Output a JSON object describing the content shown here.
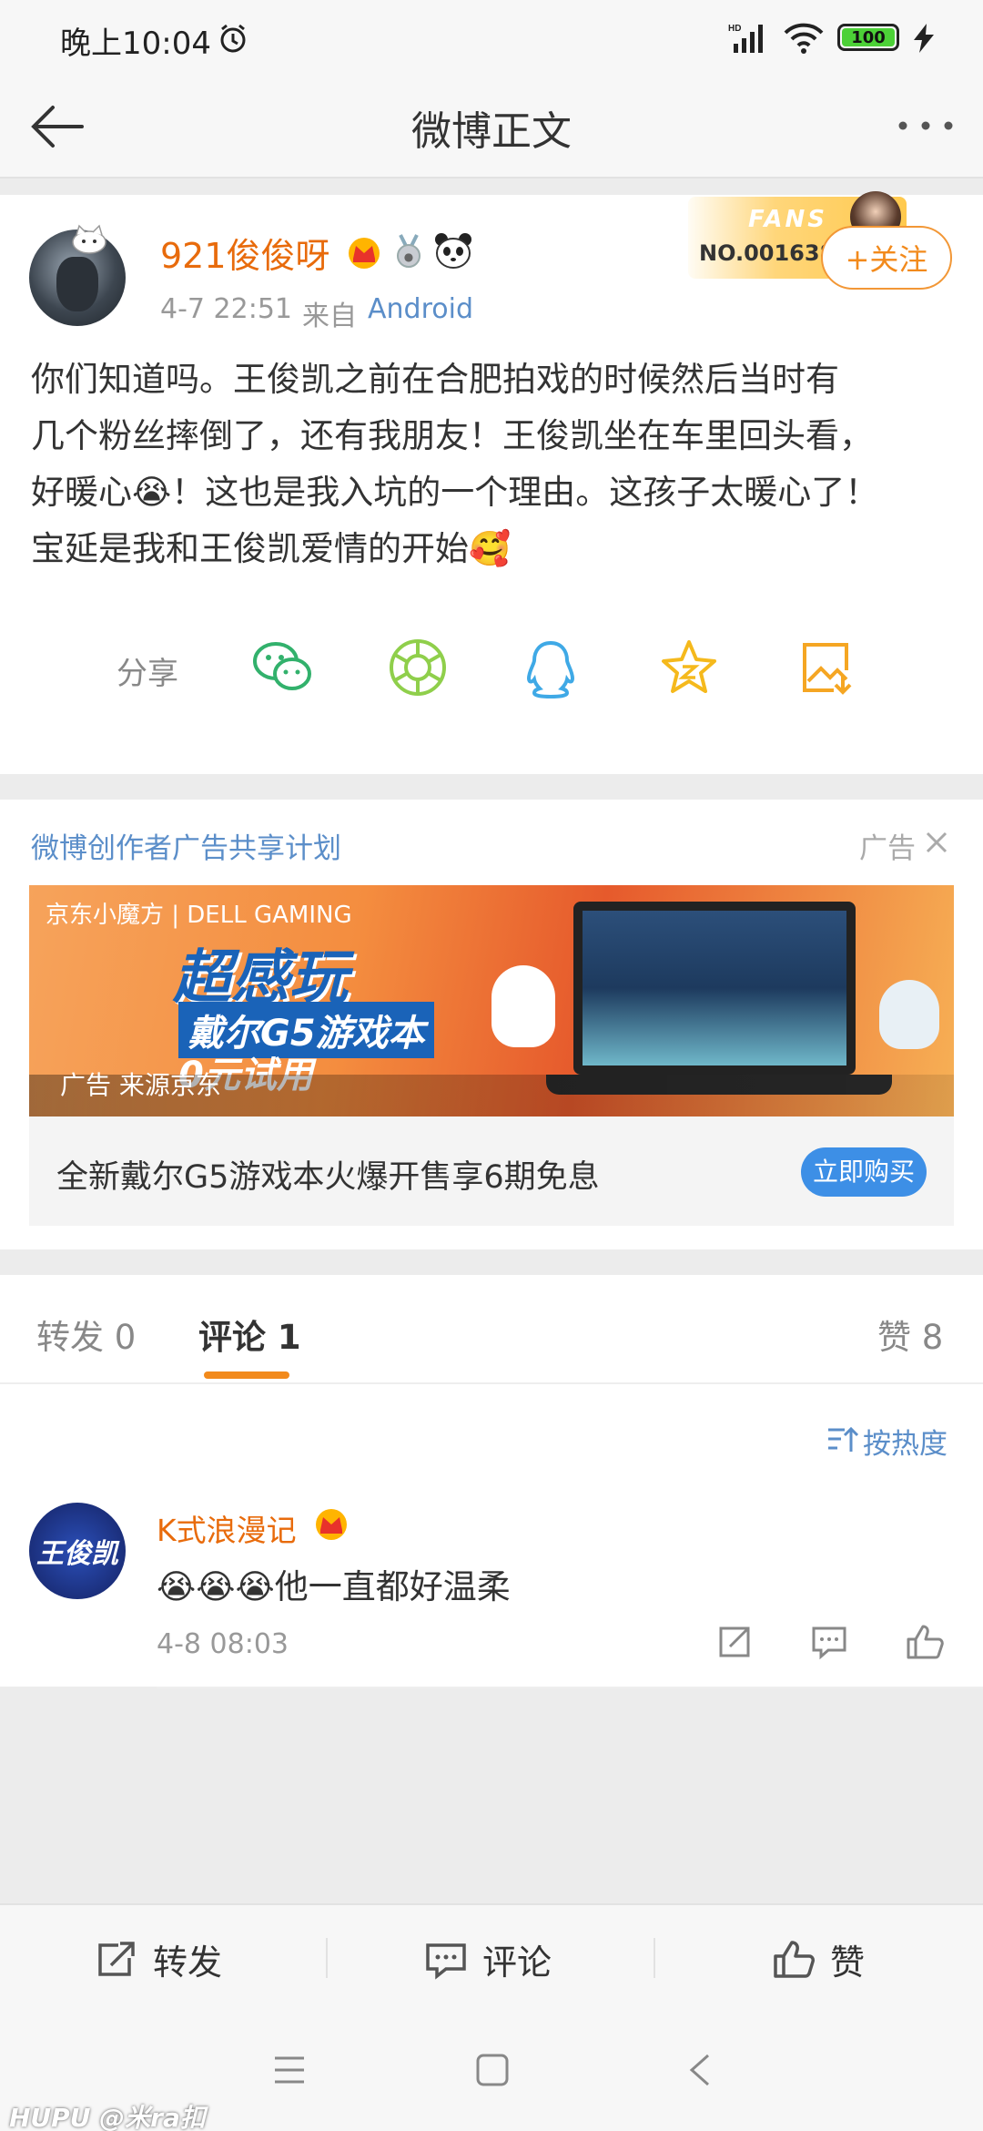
{
  "status_bar": {
    "time": "晚上10:04",
    "battery": "100"
  },
  "nav": {
    "title": "微博正文"
  },
  "post": {
    "username": "921俊俊呀",
    "time": "4-7 22:51",
    "from_label": "来自",
    "source": "Android",
    "fans_badge": {
      "word": "FANS",
      "number": "NO.001638"
    },
    "follow_label": "+关注",
    "text_lines": [
      "你们知道吗。王俊凯之前在合肥拍戏的时候然后当时有",
      "几个粉丝摔倒了，还有我朋友！王俊凯坐在车里回头看，",
      "好暖心😭！这也是我入坑的一个理由。这孩子太暖心了！",
      "宝延是我和王俊凯爱情的开始🥰"
    ],
    "share_label": "分享"
  },
  "ad": {
    "header": "微博创作者广告共享计划",
    "tag": "广告",
    "banner_logo": "京东小魔方 | DELL GAMING",
    "banner_big": "超感玩",
    "banner_sub": "戴尔G5游戏本",
    "banner_zero": "0元试用",
    "banner_source": "广告 来源京东",
    "title": "全新戴尔G5游戏本火爆开售享6期免息",
    "buy_label": "立即购买"
  },
  "tabs": {
    "repost": "转发 0",
    "comment": "评论 1",
    "like": "赞 8"
  },
  "sort_label": "按热度",
  "comment": {
    "avatar_text": "王俊凯",
    "name": "K式浪漫记",
    "text": "😭😭😭他一直都好温柔",
    "time": "4-8 08:03"
  },
  "bottom_bar": {
    "repost": "转发",
    "comment": "评论",
    "like": "赞"
  },
  "watermark": "HUPU @米ra扣"
}
